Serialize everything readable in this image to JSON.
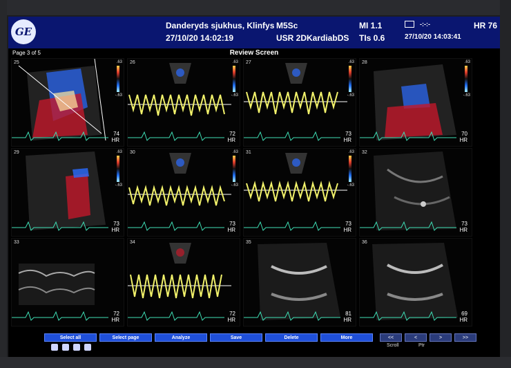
{
  "header": {
    "institution": "Danderyds sjukhus, Klinfys",
    "datetime_left": "27/10/20 14:02:19",
    "probe": "M5Sc",
    "user": "USR 2DKardiabDS",
    "mi": "MI 1.1",
    "tis": "TIs 0.6",
    "datetime_right": "27/10/20 14:03:41",
    "hr": "HR 76",
    "status_placeholder": "-:-:-"
  },
  "subbar": {
    "page_label": "Page 3 of 5",
    "screen_title": "Review Screen"
  },
  "tiles": [
    {
      "num": "25",
      "hr_value": "74",
      "hr_unit": "HR",
      "scale_top": ".63",
      "scale_bottom": "-.63"
    },
    {
      "num": "26",
      "hr_value": "72",
      "hr_unit": "HR",
      "scale_top": ".63",
      "scale_bottom": "-.63"
    },
    {
      "num": "27",
      "hr_value": "73",
      "hr_unit": "HR",
      "scale_top": ".63",
      "scale_bottom": "-.63"
    },
    {
      "num": "28",
      "hr_value": "70",
      "hr_unit": "HR",
      "scale_top": ".63",
      "scale_bottom": "-.63"
    },
    {
      "num": "29",
      "hr_value": "73",
      "hr_unit": "HR",
      "scale_top": ".63",
      "scale_bottom": "-.63"
    },
    {
      "num": "30",
      "hr_value": "73",
      "hr_unit": "HR",
      "scale_top": ".63",
      "scale_bottom": "-.63"
    },
    {
      "num": "31",
      "hr_value": "73",
      "hr_unit": "HR",
      "scale_top": ".63",
      "scale_bottom": "-.63"
    },
    {
      "num": "32",
      "hr_value": "73",
      "hr_unit": "HR",
      "scale_top": "",
      "scale_bottom": ""
    },
    {
      "num": "33",
      "hr_value": "72",
      "hr_unit": "HR",
      "scale_top": "",
      "scale_bottom": ""
    },
    {
      "num": "34",
      "hr_value": "72",
      "hr_unit": "HR",
      "scale_top": "",
      "scale_bottom": ""
    },
    {
      "num": "35",
      "hr_value": "81",
      "hr_unit": "HR",
      "scale_top": "",
      "scale_bottom": ""
    },
    {
      "num": "36",
      "hr_value": "69",
      "hr_unit": "HR",
      "scale_top": "",
      "scale_bottom": ""
    }
  ],
  "buttons": {
    "select_all": "Select all",
    "select_page": "Select page",
    "analyze": "Analyze",
    "save": "Save",
    "delete": "Delete",
    "more": "More"
  },
  "nav": {
    "first": "<<",
    "prev": "<",
    "next": ">",
    "last": ">>",
    "scroll_label": "Scroll",
    "ptr_label": "Ptr"
  },
  "colors": {
    "header_bg": "#0a1670",
    "button_bg": "#1f4fd8",
    "doppler_yellow": "#f2f26b",
    "ecg_green": "#3fe0b6",
    "flow_red": "#c2182a",
    "flow_blue": "#2b6bff"
  },
  "icons": [
    "ge-logo",
    "eraser-icon",
    "printer-icon",
    "disk-icon",
    "sd-card-icon"
  ]
}
